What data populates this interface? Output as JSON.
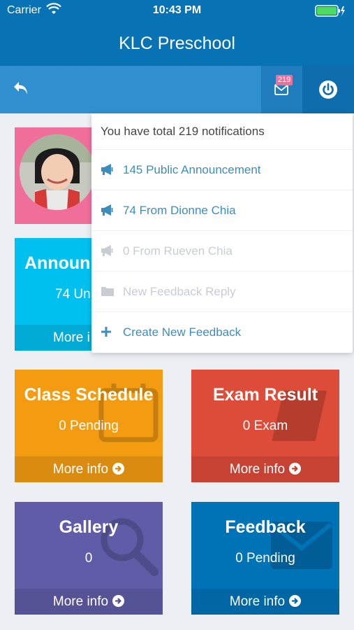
{
  "status_bar": {
    "carrier": "Carrier",
    "time": "10:43 PM"
  },
  "app": {
    "title": "KLC Preschool"
  },
  "toolbar": {
    "badge_count": "219"
  },
  "notifications": {
    "header": "You have total 219 notifications",
    "items": [
      {
        "label": "145 Public Announcement",
        "icon": "bullhorn-icon",
        "state": "active"
      },
      {
        "label": "74 From Dionne Chia",
        "icon": "bullhorn-icon",
        "state": "active"
      },
      {
        "label": "0 From Rueven Chia",
        "icon": "bullhorn-icon",
        "state": "dim"
      },
      {
        "label": "New Feedback Reply",
        "icon": "folder-icon",
        "state": "dim"
      },
      {
        "label": "Create New Feedback",
        "icon": "plus-icon",
        "state": "active"
      }
    ]
  },
  "tiles": {
    "announcement": {
      "title": "Announ",
      "subtitle": "74 Un",
      "more": "More i",
      "color": "#00c0ef"
    },
    "class_schedule": {
      "title": "Class Schedule",
      "subtitle": "0 Pending",
      "more": "More info",
      "color": "#f39c12"
    },
    "exam_result": {
      "title": "Exam Result",
      "subtitle": "0 Exam",
      "more": "More info",
      "color": "#dd4b39"
    },
    "gallery": {
      "title": "Gallery",
      "subtitle": "0",
      "more": "More info",
      "color": "#605ca8"
    },
    "feedback": {
      "title": "Feedback",
      "subtitle": "0 Pending",
      "more": "More info",
      "color": "#0073b7"
    }
  },
  "colors": {
    "header": "#0873b4",
    "toolbar": "#2f8fcf",
    "profile_bg": "#f06f9a"
  }
}
